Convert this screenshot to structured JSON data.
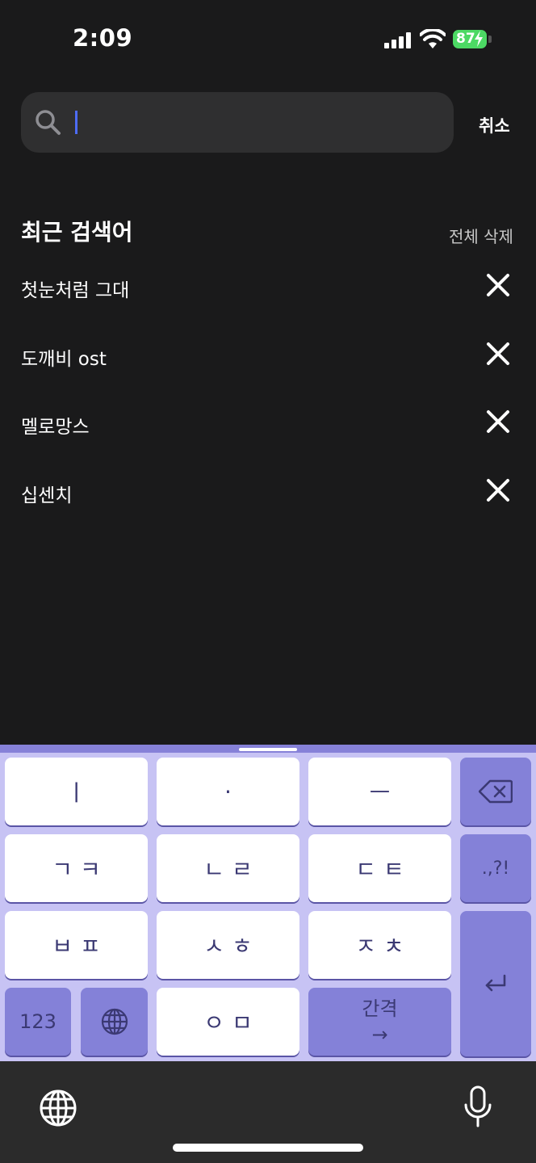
{
  "status_bar": {
    "time": "2:09",
    "battery": "87"
  },
  "search": {
    "value": "",
    "cancel_label": "취소"
  },
  "recent": {
    "title": "최근 검색어",
    "delete_all": "전체 삭제",
    "items": [
      {
        "label": "첫눈처럼 그대"
      },
      {
        "label": "도깨비 ost"
      },
      {
        "label": "멜로망스"
      },
      {
        "label": "십센치"
      }
    ]
  },
  "keyboard": {
    "row1": [
      "ㅣ",
      "·",
      "ㅡ"
    ],
    "row2": [
      "ㄱ ㅋ",
      "ㄴ ㄹ",
      "ㄷ ㅌ"
    ],
    "row3": [
      "ㅂ ㅍ",
      "ㅅ ㅎ",
      "ㅈ ㅊ"
    ],
    "punct": ".,?!",
    "numbers": "123",
    "row4_mid": "ㅇ ㅁ",
    "space_top": "간격",
    "space_bottom": "→"
  },
  "colors": {
    "background": "#1a1a1b",
    "search_bg": "#2f2f30",
    "caret": "#4d6cf5",
    "keyboard_bg": "#c7c3f4",
    "keyboard_dark_key": "#8481d8",
    "battery": "#4cd964"
  },
  "icons": [
    "search-icon",
    "close-icon",
    "backspace-icon",
    "globe-icon",
    "return-icon",
    "microphone-icon"
  ]
}
